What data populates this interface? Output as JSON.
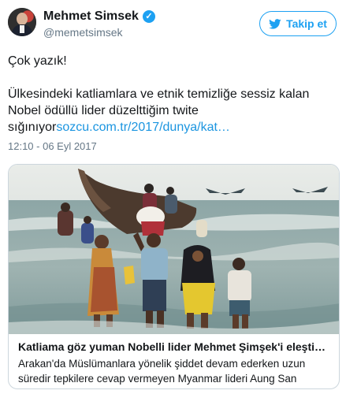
{
  "user": {
    "name": "Mehmet Simsek",
    "handle": "@memetsimsek",
    "verified": true,
    "avatar_icon": "profile-photo"
  },
  "follow_button": {
    "label": "Takip et",
    "icon": "twitter-bird-icon",
    "color": "#1da1f2"
  },
  "tweet": {
    "line1": "Çok yazık!",
    "line2": "Ülkesindeki katliamlara ve etnik temizliğe sessiz kalan",
    "line3": "Nobel ödüllü lider düzelttiğim twite",
    "line4_text": "sığınıyor",
    "line4_link": "sozcu.com.tr/2017/dunya/kat…",
    "link_color": "#1b95e0"
  },
  "timestamp": "12:10 - 06 Eyl 2017",
  "card": {
    "image": "photo-refugees-wading-from-boat",
    "title": "Katliama göz yuman Nobelli lider Mehmet Şimşek'i eleşti…",
    "description": "Arakan'da Müslümanlara yönelik şiddet devam ederken uzun süredir tepkilere cevap vermeyen Myanmar lideri Aung San"
  }
}
